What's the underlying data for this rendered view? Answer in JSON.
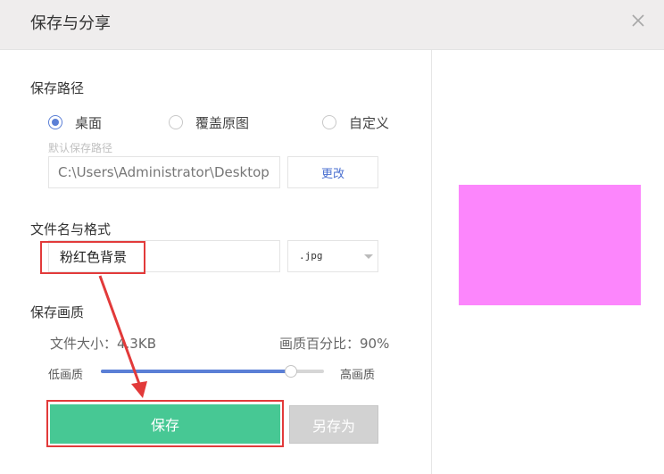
{
  "window": {
    "title": "保存与分享"
  },
  "colors": {
    "accent": "#5b7fd6",
    "primary_button": "#47c894",
    "preview_fill": "#fc86fc",
    "annotation": "#e23a3a"
  },
  "save_path": {
    "label": "保存路径",
    "options": [
      "桌面",
      "覆盖原图",
      "自定义"
    ],
    "selected": "桌面",
    "hint": "默认保存路径",
    "path_value": "C:\\Users\\Administrator\\Desktop",
    "change_button": "更改"
  },
  "file": {
    "label": "文件名与格式",
    "name_value": "粉红色背景",
    "format_selected": ".jpg"
  },
  "quality": {
    "label": "保存画质",
    "file_size_text": "文件大小：4.3KB",
    "percent_text": "画质百分比：90%",
    "low_label": "低画质",
    "high_label": "高画质",
    "slider_fraction": 0.85
  },
  "actions": {
    "save": "保存",
    "save_as": "另存为"
  }
}
